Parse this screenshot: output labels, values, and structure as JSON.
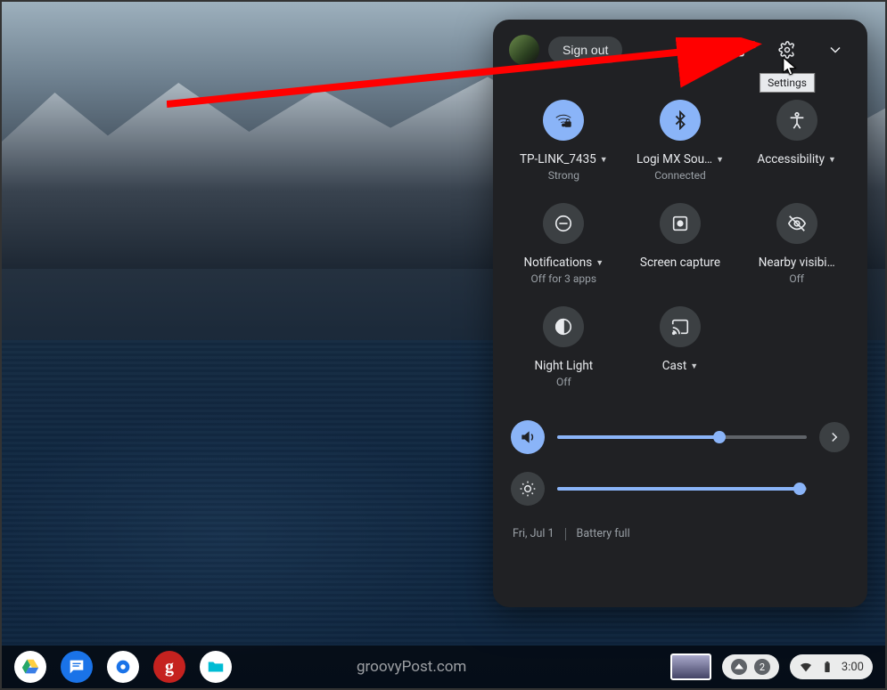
{
  "annotation": {
    "tooltip": "Settings"
  },
  "panel": {
    "signout_label": "Sign out",
    "tiles": [
      {
        "label": "TP-LINK_7435",
        "sub": "Strong",
        "has_dropdown": true,
        "active": true,
        "icon": "wifi-locked"
      },
      {
        "label": "Logi MX Sou…",
        "sub": "Connected",
        "has_dropdown": true,
        "active": true,
        "icon": "bluetooth"
      },
      {
        "label": "Accessibility",
        "sub": "",
        "has_dropdown": true,
        "active": false,
        "icon": "accessibility"
      },
      {
        "label": "Notifications",
        "sub": "Off for 3 apps",
        "has_dropdown": true,
        "active": false,
        "icon": "dnd"
      },
      {
        "label": "Screen capture",
        "sub": "",
        "has_dropdown": false,
        "active": false,
        "icon": "screen-capture"
      },
      {
        "label": "Nearby visibi…",
        "sub": "Off",
        "has_dropdown": false,
        "active": false,
        "icon": "visibility-off"
      },
      {
        "label": "Night Light",
        "sub": "Off",
        "has_dropdown": false,
        "active": false,
        "icon": "night-light"
      },
      {
        "label": "Cast",
        "sub": "",
        "has_dropdown": true,
        "active": false,
        "icon": "cast"
      }
    ],
    "volume_percent": 65,
    "brightness_percent": 97,
    "footer_date": "Fri, Jul 1",
    "footer_battery": "Battery full"
  },
  "shelf": {
    "watermark": "groovyPost.com",
    "notification_count": "2",
    "time": "3:00"
  }
}
